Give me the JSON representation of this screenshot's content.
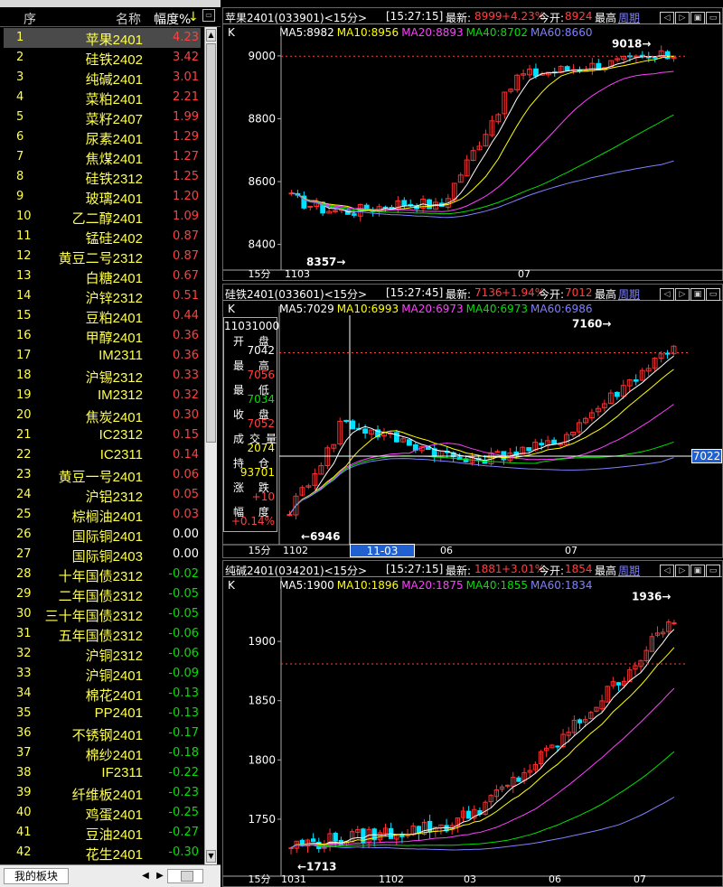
{
  "left_panel": {
    "header": {
      "no": "序",
      "name": "名称",
      "pct": "幅度%",
      "sort_icon": "arrow-down-icon"
    },
    "rows": [
      {
        "no": "1",
        "name": "苹果2401",
        "pct": "4.23",
        "dir": "up"
      },
      {
        "no": "2",
        "name": "硅铁2402",
        "pct": "3.42",
        "dir": "up"
      },
      {
        "no": "3",
        "name": "纯碱2401",
        "pct": "3.01",
        "dir": "up"
      },
      {
        "no": "4",
        "name": "菜粕2401",
        "pct": "2.21",
        "dir": "up"
      },
      {
        "no": "5",
        "name": "菜籽2407",
        "pct": "1.99",
        "dir": "up"
      },
      {
        "no": "6",
        "name": "尿素2401",
        "pct": "1.29",
        "dir": "up"
      },
      {
        "no": "7",
        "name": "焦煤2401",
        "pct": "1.27",
        "dir": "up"
      },
      {
        "no": "8",
        "name": "硅铁2312",
        "pct": "1.25",
        "dir": "up"
      },
      {
        "no": "9",
        "name": "玻璃2401",
        "pct": "1.20",
        "dir": "up"
      },
      {
        "no": "10",
        "name": "乙二醇2401",
        "pct": "1.09",
        "dir": "up"
      },
      {
        "no": "11",
        "name": "锰硅2402",
        "pct": "0.87",
        "dir": "up"
      },
      {
        "no": "12",
        "name": "黄豆二号2312",
        "pct": "0.87",
        "dir": "up"
      },
      {
        "no": "13",
        "name": "白糖2401",
        "pct": "0.67",
        "dir": "up"
      },
      {
        "no": "14",
        "name": "沪锌2312",
        "pct": "0.51",
        "dir": "up"
      },
      {
        "no": "15",
        "name": "豆粕2401",
        "pct": "0.44",
        "dir": "up"
      },
      {
        "no": "16",
        "name": "甲醇2401",
        "pct": "0.36",
        "dir": "up"
      },
      {
        "no": "17",
        "name": "IM2311",
        "pct": "0.36",
        "dir": "up"
      },
      {
        "no": "18",
        "name": "沪锡2312",
        "pct": "0.33",
        "dir": "up"
      },
      {
        "no": "19",
        "name": "IM2312",
        "pct": "0.32",
        "dir": "up"
      },
      {
        "no": "20",
        "name": "焦炭2401",
        "pct": "0.30",
        "dir": "up"
      },
      {
        "no": "21",
        "name": "IC2312",
        "pct": "0.15",
        "dir": "up"
      },
      {
        "no": "22",
        "name": "IC2311",
        "pct": "0.14",
        "dir": "up"
      },
      {
        "no": "23",
        "name": "黄豆一号2401",
        "pct": "0.06",
        "dir": "up"
      },
      {
        "no": "24",
        "name": "沪铝2312",
        "pct": "0.05",
        "dir": "up"
      },
      {
        "no": "25",
        "name": "棕榈油2401",
        "pct": "0.03",
        "dir": "up"
      },
      {
        "no": "26",
        "name": "国际铜2401",
        "pct": "0.00",
        "dir": "eq"
      },
      {
        "no": "27",
        "name": "国际铜2403",
        "pct": "0.00",
        "dir": "eq"
      },
      {
        "no": "28",
        "name": "十年国债2312",
        "pct": "-0.02",
        "dir": "dn"
      },
      {
        "no": "29",
        "name": "二年国债2312",
        "pct": "-0.05",
        "dir": "dn"
      },
      {
        "no": "30",
        "name": "三十年国债2312",
        "pct": "-0.05",
        "dir": "dn"
      },
      {
        "no": "31",
        "name": "五年国债2312",
        "pct": "-0.06",
        "dir": "dn"
      },
      {
        "no": "32",
        "name": "沪铜2312",
        "pct": "-0.06",
        "dir": "dn"
      },
      {
        "no": "33",
        "name": "沪铜2401",
        "pct": "-0.09",
        "dir": "dn"
      },
      {
        "no": "34",
        "name": "棉花2401",
        "pct": "-0.13",
        "dir": "dn"
      },
      {
        "no": "35",
        "name": "PP2401",
        "pct": "-0.13",
        "dir": "dn"
      },
      {
        "no": "36",
        "name": "不锈钢2401",
        "pct": "-0.17",
        "dir": "dn"
      },
      {
        "no": "37",
        "name": "棉纱2401",
        "pct": "-0.18",
        "dir": "dn"
      },
      {
        "no": "38",
        "name": "IF2311",
        "pct": "-0.22",
        "dir": "dn"
      },
      {
        "no": "39",
        "name": "纤维板2401",
        "pct": "-0.23",
        "dir": "dn"
      },
      {
        "no": "40",
        "name": "鸡蛋2401",
        "pct": "-0.25",
        "dir": "dn"
      },
      {
        "no": "41",
        "name": "豆油2401",
        "pct": "-0.27",
        "dir": "dn"
      },
      {
        "no": "42",
        "name": "花生2401",
        "pct": "-0.30",
        "dir": "dn"
      }
    ],
    "footer": {
      "tab": "我的板块",
      "prev_icon": "triangle-left-icon",
      "next_icon": "triangle-right-icon"
    }
  },
  "colors": {
    "up": "#ff4040",
    "down": "#00e000",
    "name": "#ffff4d",
    "ma5": "#ffffff",
    "ma10": "#ffff00",
    "ma20": "#ff40ff",
    "ma40": "#00e000",
    "ma60": "#8080ff",
    "bull": "#ff3030",
    "bear": "#00e0ff"
  },
  "panels": [
    {
      "title": "苹果2401(033901)<15分>",
      "time": "[15:27:15]",
      "last_label": "最新:",
      "last": "8999",
      "chg": "+4.23%",
      "open_label": "今开:",
      "open": "8924",
      "hl_label": "最高",
      "period_label": "周期",
      "k_label": "K",
      "ma": [
        "MA5:8982",
        "MA10:8956",
        "MA20:8893",
        "MA40:8702",
        "MA60:8660"
      ],
      "y_ticks": [
        "9000",
        "8800",
        "8600",
        "8400"
      ],
      "y_tick_values": [
        9000,
        8800,
        8600,
        8400
      ],
      "y_range": [
        8330,
        9060
      ],
      "x_labels": [
        "15分",
        "1103",
        "07"
      ],
      "annot_high": "9018",
      "annot_low": "8357",
      "dashed_value": 8999
    },
    {
      "title": "硅铁2401(033601)<15分>",
      "time": "[15:27:45]",
      "last_label": "最新:",
      "last": "7136",
      "chg": "+1.94%",
      "open_label": "今开:",
      "open": "7012",
      "hl_label": "最高",
      "period_label": "周期",
      "k_label": "K",
      "ma": [
        "MA5:7029",
        "MA10:6993",
        "MA20:6973",
        "MA40:6973",
        "MA60:6986"
      ],
      "x_labels": [
        "15分",
        "1102",
        "06",
        "07"
      ],
      "cursor_time": "11-03 10:00",
      "cursor_price": "7022",
      "annot_high": "7160",
      "annot_low": "6946",
      "y_range": [
        6930,
        7175
      ],
      "dashed_value": 7136,
      "info": {
        "date": "11031000",
        "open_label": "开 盘",
        "open": "7042",
        "high_label": "最 高",
        "high": "7056",
        "low_label": "最 低",
        "low": "7034",
        "close_label": "收 盘",
        "close": "7052",
        "vol_label": "成交量",
        "vol": "2074",
        "oi_label": "持 仓",
        "oi": "93701",
        "chg_label": "涨 跌",
        "chg": "+10",
        "pct_label": "幅 度",
        "pct": "+0.14%"
      }
    },
    {
      "title": "纯碱2401(034201)<15分>",
      "time": "[15:27:15]",
      "last_label": "最新:",
      "last": "1881",
      "chg": "+3.01%",
      "open_label": "今开:",
      "open": "1854",
      "hl_label": "最高",
      "period_label": "周期",
      "k_label": "K",
      "ma": [
        "MA5:1900",
        "MA10:1896",
        "MA20:1875",
        "MA40:1855",
        "MA60:1834"
      ],
      "y_ticks": [
        "1900",
        "1850",
        "1800",
        "1750"
      ],
      "y_tick_values": [
        1900,
        1850,
        1800,
        1750
      ],
      "y_range": [
        1705,
        1945
      ],
      "x_labels": [
        "15分",
        "1031",
        "1102",
        "03",
        "06",
        "07"
      ],
      "annot_high": "1936",
      "annot_low": "1713",
      "dashed_value": 1881
    }
  ]
}
